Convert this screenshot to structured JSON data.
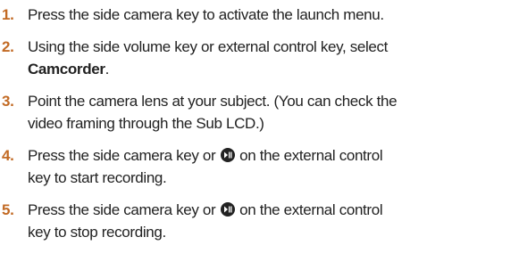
{
  "accent_color": "#c26a24",
  "text_color": "#222222",
  "steps": [
    {
      "number": "1.",
      "line1": "Press the side camera key to activate the launch menu."
    },
    {
      "number": "2.",
      "line1": "Using the side volume key or external control key, select",
      "line2_bold": "Camcorder",
      "line2_rest": "."
    },
    {
      "number": "3.",
      "line1": "Point the camera lens at your subject. (You can check the",
      "line2": "video framing through the Sub LCD.)"
    },
    {
      "number": "4.",
      "line1_before": "Press the side camera key or",
      "icon": "play-pause-icon",
      "line1_after": "on the external control",
      "line2": "key to start recording."
    },
    {
      "number": "5.",
      "line1_before": "Press the side camera key or",
      "icon": "play-pause-icon",
      "line1_after": "on the external control",
      "line2": "key to stop recording."
    }
  ]
}
